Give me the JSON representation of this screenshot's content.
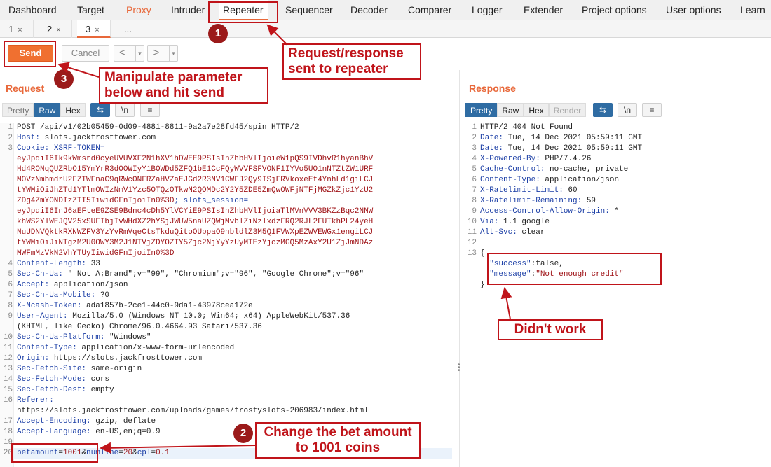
{
  "top_tabs": [
    "Dashboard",
    "Target",
    "Proxy",
    "Intruder",
    "Repeater",
    "Sequencer",
    "Decoder",
    "Comparer",
    "Logger",
    "Extender",
    "Project options",
    "User options",
    "Learn"
  ],
  "sub_tabs": [
    {
      "label": "1",
      "close": "×"
    },
    {
      "label": "2",
      "close": "×"
    },
    {
      "label": "3",
      "close": "×"
    },
    {
      "label": "...",
      "close": ""
    }
  ],
  "toolbar": {
    "send": "Send",
    "cancel": "Cancel",
    "back": "<",
    "forward": ">",
    "dropdown": "▾"
  },
  "request": {
    "title": "Request",
    "view_tabs": [
      "Pretty",
      "Raw",
      "Hex"
    ],
    "icons": [
      "wrap-icon",
      "newline-icon",
      "menu-icon"
    ],
    "icon_glyphs": [
      "⇆",
      "\\n",
      "≡"
    ],
    "lines": [
      {
        "n": "1",
        "segs": [
          {
            "t": "POST /api/v1/02b05459-0d09-4881-8811-9a2a7e28fd45/spin HTTP/2",
            "c": "val"
          }
        ]
      },
      {
        "n": "2",
        "segs": [
          {
            "t": "Host:",
            "c": "hdr"
          },
          {
            "t": " slots.jackfrosttower.com",
            "c": "val"
          }
        ]
      },
      {
        "n": "3",
        "segs": [
          {
            "t": "Cookie:",
            "c": "hdr"
          },
          {
            "t": " XSRF-TOKEN=",
            "c": "hdr"
          }
        ]
      },
      {
        "n": "",
        "segs": [
          {
            "t": "eyJpdiI6Ik9kWmsrd0cyeUVUVXF2N1hXV1hDWEE9PSIsInZhbHVlIjoieW1pQS9IVDhvR1hyanBhV",
            "c": "ck"
          }
        ]
      },
      {
        "n": "",
        "segs": [
          {
            "t": "Hd4RONqQUZRbO15YmYrR3dOOWIyY1BOWDd5ZFQ1bE1CcFQyWVVFSFVONF1IYVo5UO1nNTZtZW1URF",
            "c": "ck"
          }
        ]
      },
      {
        "n": "",
        "segs": [
          {
            "t": "MOVzNmbmdrU2FZTWFnaC9qRWcONFRZaHVZaEJGd2R3NV1CWFJ2Qy9ISjFRVkoxeEt4YnhLd1giLCJ",
            "c": "ck"
          }
        ]
      },
      {
        "n": "",
        "segs": [
          {
            "t": "tYWMiOiJhZTd1YTlmOWIzNmV1Yzc5OTQzOTkwN2QOMDc2Y2Y5ZDE5ZmQwOWFjNTFjMGZkZjc1YzU2",
            "c": "ck"
          }
        ]
      },
      {
        "n": "",
        "segs": [
          {
            "t": "ZDg4ZmYONDIzZTI5IiwidGFnIjoiIn0%3D",
            "c": "ck"
          },
          {
            "t": "; slots_session=",
            "c": "hdr"
          }
        ]
      },
      {
        "n": "",
        "segs": [
          {
            "t": "eyJpdiI6InJ6aEFteE9ZSE9Bdnc4cDh5YlVCYiE9PSIsInZhbHVlIjoiaTlMVnVVV3BKZzBqc2NNW",
            "c": "ck"
          }
        ]
      },
      {
        "n": "",
        "segs": [
          {
            "t": "khWS2YlWEJQV25xSUFIbjIvWHdXZ2hYSjJWUW5naUZQWjMvblZiNzlxdzFRQ2RJL2FUTkhPL24yeH",
            "c": "ck"
          }
        ]
      },
      {
        "n": "",
        "segs": [
          {
            "t": "NuUDNVQktkRXNWZFV3YzYvRmVqeCtsTkduQitoOUppaO9nbldlZ3M5Q1FVWXpEZWVEWGx1engiLCJ",
            "c": "ck"
          }
        ]
      },
      {
        "n": "",
        "segs": [
          {
            "t": "tYWMiOiJiNTgzM2U0OWY3M2J1NTVjZDYOZTY5Zjc2NjYyYzUyMTEzYjczMGQ5MzAxY2U1ZjJmNDAz",
            "c": "ck"
          }
        ]
      },
      {
        "n": "",
        "segs": [
          {
            "t": "MWFmMzVkN2VhYTUyIiwidGFnIjoiIn0%3D",
            "c": "ck"
          }
        ]
      },
      {
        "n": "4",
        "segs": [
          {
            "t": "Content-Length:",
            "c": "hdr"
          },
          {
            "t": " 33",
            "c": "val"
          }
        ]
      },
      {
        "n": "5",
        "segs": [
          {
            "t": "Sec-Ch-Ua:",
            "c": "hdr"
          },
          {
            "t": " \" Not A;Brand\";v=\"99\", \"Chromium\";v=\"96\", \"Google Chrome\";v=\"96\"",
            "c": "val"
          }
        ]
      },
      {
        "n": "6",
        "segs": [
          {
            "t": "Accept:",
            "c": "hdr"
          },
          {
            "t": " application/json",
            "c": "val"
          }
        ]
      },
      {
        "n": "7",
        "segs": [
          {
            "t": "Sec-Ch-Ua-Mobile:",
            "c": "hdr"
          },
          {
            "t": " ?0",
            "c": "val"
          }
        ]
      },
      {
        "n": "8",
        "segs": [
          {
            "t": "X-Ncash-Token:",
            "c": "hdr"
          },
          {
            "t": " ada1857b-2ce1-44c0-9da1-43978cea172e",
            "c": "val"
          }
        ]
      },
      {
        "n": "9",
        "segs": [
          {
            "t": "User-Agent:",
            "c": "hdr"
          },
          {
            "t": " Mozilla/5.0 (Windows NT 10.0; Win64; x64) AppleWebKit/537.36",
            "c": "val"
          }
        ]
      },
      {
        "n": "",
        "segs": [
          {
            "t": "(KHTML, like Gecko) Chrome/96.0.4664.93 Safari/537.36",
            "c": "val"
          }
        ]
      },
      {
        "n": "10",
        "segs": [
          {
            "t": "Sec-Ch-Ua-Platform:",
            "c": "hdr"
          },
          {
            "t": " \"Windows\"",
            "c": "val"
          }
        ]
      },
      {
        "n": "11",
        "segs": [
          {
            "t": "Content-Type:",
            "c": "hdr"
          },
          {
            "t": " application/x-www-form-urlencoded",
            "c": "val"
          }
        ]
      },
      {
        "n": "12",
        "segs": [
          {
            "t": "Origin:",
            "c": "hdr"
          },
          {
            "t": " https://slots.jackfrosttower.com",
            "c": "val"
          }
        ]
      },
      {
        "n": "13",
        "segs": [
          {
            "t": "Sec-Fetch-Site:",
            "c": "hdr"
          },
          {
            "t": " same-origin",
            "c": "val"
          }
        ]
      },
      {
        "n": "14",
        "segs": [
          {
            "t": "Sec-Fetch-Mode:",
            "c": "hdr"
          },
          {
            "t": " cors",
            "c": "val"
          }
        ]
      },
      {
        "n": "15",
        "segs": [
          {
            "t": "Sec-Fetch-Dest:",
            "c": "hdr"
          },
          {
            "t": " empty",
            "c": "val"
          }
        ]
      },
      {
        "n": "16",
        "segs": [
          {
            "t": "Referer:",
            "c": "hdr"
          }
        ]
      },
      {
        "n": "",
        "segs": [
          {
            "t": "https://slots.jackfrosttower.com/uploads/games/frostyslots-206983/index.html",
            "c": "val"
          }
        ]
      },
      {
        "n": "17",
        "segs": [
          {
            "t": "Accept-Encoding:",
            "c": "hdr"
          },
          {
            "t": " gzip, deflate",
            "c": "val"
          }
        ]
      },
      {
        "n": "18",
        "segs": [
          {
            "t": "Accept-Language:",
            "c": "hdr"
          },
          {
            "t": " en-US,en;q=0.9",
            "c": "val"
          }
        ]
      },
      {
        "n": "19",
        "segs": []
      },
      {
        "n": "20",
        "segs": [
          {
            "t": "betamount",
            "c": "hdr"
          },
          {
            "t": "=",
            "c": "val"
          },
          {
            "t": "1001",
            "c": "ck"
          },
          {
            "t": "&",
            "c": "val"
          },
          {
            "t": "numline",
            "c": "hdr"
          },
          {
            "t": "=",
            "c": "val"
          },
          {
            "t": "20",
            "c": "ck"
          },
          {
            "t": "&",
            "c": "val"
          },
          {
            "t": "cpl",
            "c": "hdr"
          },
          {
            "t": "=",
            "c": "val"
          },
          {
            "t": "0.1",
            "c": "ck"
          }
        ]
      }
    ]
  },
  "response": {
    "title": "Response",
    "view_tabs": [
      "Pretty",
      "Raw",
      "Hex",
      "Render"
    ],
    "icons": [
      "wrap-icon",
      "newline-icon",
      "menu-icon"
    ],
    "icon_glyphs": [
      "⇆",
      "\\n",
      "≡"
    ],
    "lines": [
      {
        "n": "1",
        "segs": [
          {
            "t": "HTTP/2 404 Not Found",
            "c": "val"
          }
        ]
      },
      {
        "n": "2",
        "segs": [
          {
            "t": "Date:",
            "c": "hdr"
          },
          {
            "t": " Tue, 14 Dec 2021 05:59:11 GMT",
            "c": "val"
          }
        ]
      },
      {
        "n": "3",
        "segs": [
          {
            "t": "Date:",
            "c": "hdr"
          },
          {
            "t": " Tue, 14 Dec 2021 05:59:11 GMT",
            "c": "val"
          }
        ]
      },
      {
        "n": "4",
        "segs": [
          {
            "t": "X-Powered-By:",
            "c": "hdr"
          },
          {
            "t": " PHP/7.4.26",
            "c": "val"
          }
        ]
      },
      {
        "n": "5",
        "segs": [
          {
            "t": "Cache-Control:",
            "c": "hdr"
          },
          {
            "t": " no-cache, private",
            "c": "val"
          }
        ]
      },
      {
        "n": "6",
        "segs": [
          {
            "t": "Content-Type:",
            "c": "hdr"
          },
          {
            "t": " application/json",
            "c": "val"
          }
        ]
      },
      {
        "n": "7",
        "segs": [
          {
            "t": "X-Ratelimit-Limit:",
            "c": "hdr"
          },
          {
            "t": " 60",
            "c": "val"
          }
        ]
      },
      {
        "n": "8",
        "segs": [
          {
            "t": "X-Ratelimit-Remaining:",
            "c": "hdr"
          },
          {
            "t": " 59",
            "c": "val"
          }
        ]
      },
      {
        "n": "9",
        "segs": [
          {
            "t": "Access-Control-Allow-Origin:",
            "c": "hdr"
          },
          {
            "t": " *",
            "c": "val"
          }
        ]
      },
      {
        "n": "10",
        "segs": [
          {
            "t": "Via:",
            "c": "hdr"
          },
          {
            "t": " 1.1 google",
            "c": "val"
          }
        ]
      },
      {
        "n": "11",
        "segs": [
          {
            "t": "Alt-Svc:",
            "c": "hdr"
          },
          {
            "t": " clear",
            "c": "val"
          }
        ]
      },
      {
        "n": "12",
        "segs": []
      },
      {
        "n": "13",
        "segs": [
          {
            "t": "{",
            "c": "val"
          }
        ]
      },
      {
        "n": "",
        "segs": [
          {
            "t": "  \"success\"",
            "c": "hdr"
          },
          {
            "t": ":false,",
            "c": "val"
          }
        ]
      },
      {
        "n": "",
        "segs": [
          {
            "t": "  \"message\"",
            "c": "hdr"
          },
          {
            "t": ":",
            "c": "val"
          },
          {
            "t": "\"Not enough credit\"",
            "c": "ck"
          }
        ]
      },
      {
        "n": "",
        "segs": [
          {
            "t": "}",
            "c": "val"
          }
        ]
      }
    ]
  },
  "annotations": {
    "badge1": "1",
    "badge2": "2",
    "badge3": "3",
    "callout_repeater": [
      "Request/response",
      "sent to repeater"
    ],
    "callout_manipulate": [
      "Manipulate parameter",
      "below and hit send"
    ],
    "callout_didnt_work": [
      "Didn't work"
    ],
    "callout_change_bet": [
      "Change the bet amount",
      "to 1001 coins"
    ]
  },
  "colors": {
    "accent": "#e8683a",
    "annotation": "#c0141a",
    "header_key": "#1c3fa6",
    "value_red": "#a0161a",
    "tab_active": "#2f6ca3"
  }
}
